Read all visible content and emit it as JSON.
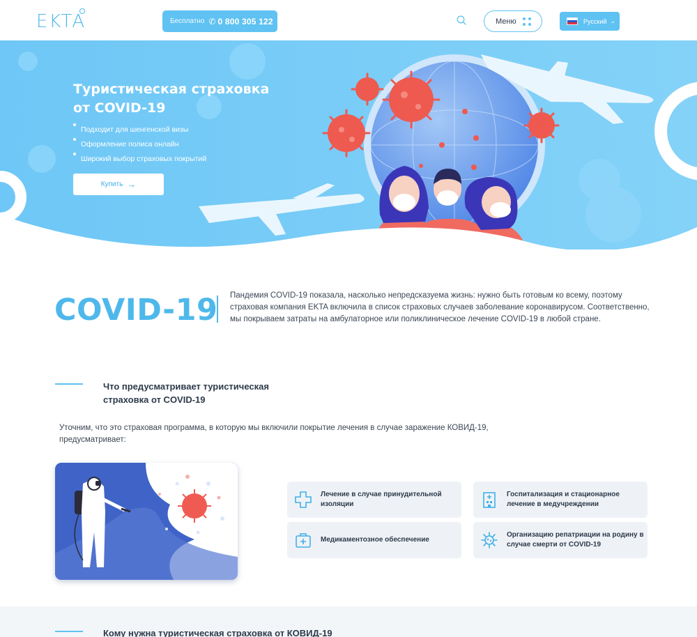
{
  "header": {
    "logo": "EKTA",
    "phone": {
      "free_label": "Бесплатно",
      "number": "0 800 305 122"
    },
    "menu_label": "Меню",
    "language": "Русский"
  },
  "hero": {
    "title": "Туристическая страховка от COVID-19",
    "bullets": [
      "Подходит для шенгенской визы",
      "Оформление полиса онлайн",
      "Широкий выбор страховых покрытий"
    ],
    "buy_label": "Купить"
  },
  "intro": {
    "heading": "COVID-19",
    "text": "Пандемия COVID-19 показала, насколько непредсказуема жизнь: нужно быть готовым ко всему, поэтому страховая компания EKTA включила в список страховых случаев заболевание коронавирусом. Соответственно, мы покрываем затраты на амбулаторное или поликлиническое лечение COVID-19  в любой стране."
  },
  "coverage": {
    "title": "Что предусматривает туристическая страховка от COVID-19",
    "subtitle": "Уточним, что это страховая программа, в которую мы включили покрытие лечения в случае заражение КОВИД-19, предусматривает:",
    "items": [
      {
        "label": "Лечение в случае принудительной изоляции",
        "icon": "medical-cross-icon"
      },
      {
        "label": "Госпитализация и стационарное лечение в медучреждении",
        "icon": "hospital-building-icon"
      },
      {
        "label": "Медикаментозное обеспечение",
        "icon": "medicine-case-icon"
      },
      {
        "label": "Организацию репатриации на родину в случае смерти от COVID-19",
        "icon": "virus-icon"
      }
    ]
  },
  "who_needs": {
    "title": "Кому нужна туристическая страховка от КОВИД-19"
  },
  "colors": {
    "accent": "#5fc2f2",
    "brand_blue": "#4fb8ea",
    "hero_bg": "#7ccdf7",
    "virus_red": "#ee5a4f",
    "card_bg": "#eef2f6"
  }
}
